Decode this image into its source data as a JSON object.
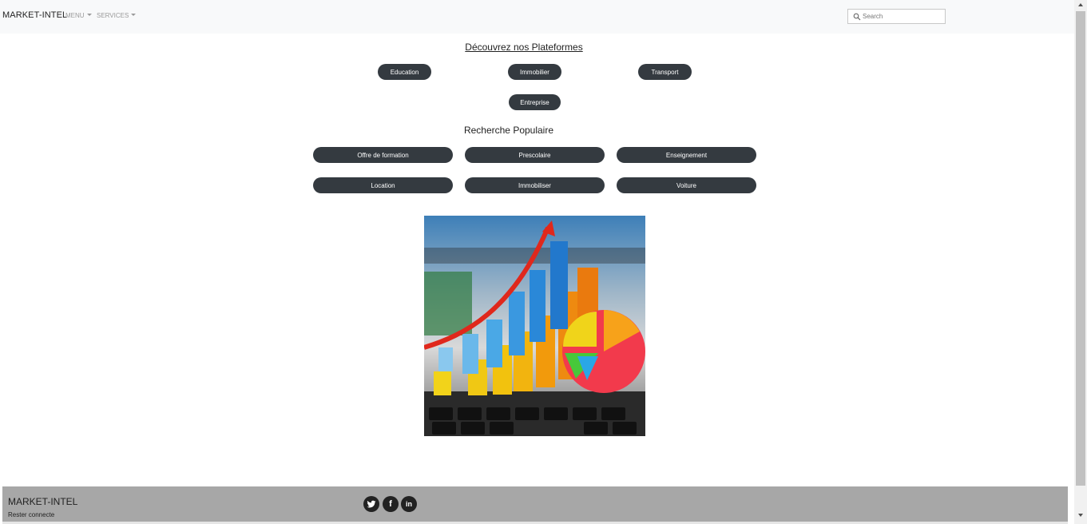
{
  "navbar": {
    "brand": "MARKET-INTEL",
    "menu_label": "MENU",
    "services_label": "SERVICES",
    "search_placeholder": "Search"
  },
  "platforms": {
    "title": "Découvrez nos Plateformes",
    "buttons": [
      "Education",
      "Immobilier",
      "Transport",
      "Entreprise"
    ]
  },
  "popular": {
    "title": "Recherche Populaire",
    "buttons": [
      "Offre de formation",
      "Prescolaire",
      "Enseignement",
      "Location",
      "Immobiliser",
      "Voiture"
    ]
  },
  "footer": {
    "brand": "MARKET-INTEL",
    "tagline": "Rester connecte",
    "social_icons": [
      "twitter-icon",
      "facebook-icon",
      "linkedin-icon"
    ],
    "social_glyphs": [
      "t",
      "f",
      "in"
    ]
  },
  "colors": {
    "button_bg": "#343a40",
    "navbar_bg": "#f8f9fa",
    "footer_bg": "#a7a7a7"
  }
}
